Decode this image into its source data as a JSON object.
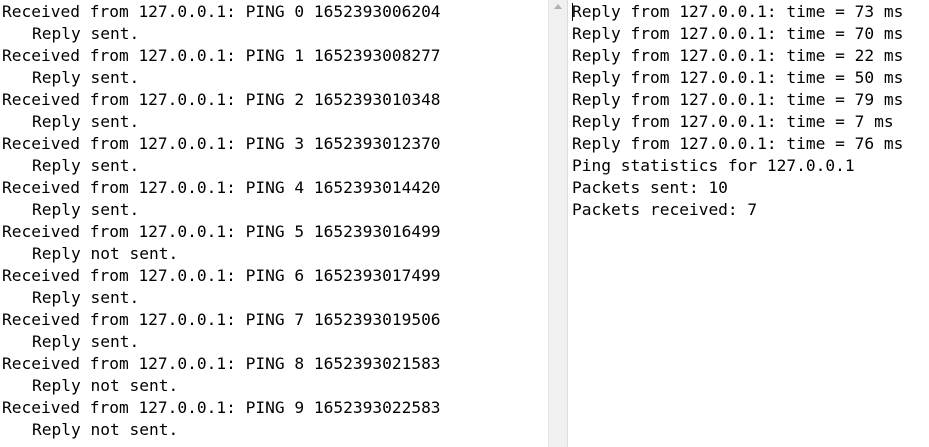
{
  "left_output": [
    {
      "received": "Received from 127.0.0.1: PING 0 1652393006204",
      "reply": "Reply sent."
    },
    {
      "received": "Received from 127.0.0.1: PING 1 1652393008277",
      "reply": "Reply sent."
    },
    {
      "received": "Received from 127.0.0.1: PING 2 1652393010348",
      "reply": "Reply sent."
    },
    {
      "received": "Received from 127.0.0.1: PING 3 1652393012370",
      "reply": "Reply sent."
    },
    {
      "received": "Received from 127.0.0.1: PING 4 1652393014420",
      "reply": "Reply sent."
    },
    {
      "received": "Received from 127.0.0.1: PING 5 1652393016499",
      "reply": "Reply not sent."
    },
    {
      "received": "Received from 127.0.0.1: PING 6 1652393017499",
      "reply": "Reply sent."
    },
    {
      "received": "Received from 127.0.0.1: PING 7 1652393019506",
      "reply": "Reply sent."
    },
    {
      "received": "Received from 127.0.0.1: PING 8 1652393021583",
      "reply": "Reply not sent."
    },
    {
      "received": "Received from 127.0.0.1: PING 9 1652393022583",
      "reply": "Reply not sent."
    }
  ],
  "right_output": [
    "Reply from 127.0.0.1: time = 73 ms",
    "Reply from 127.0.0.1: time = 70 ms",
    "Reply from 127.0.0.1: time = 22 ms",
    "Reply from 127.0.0.1: time = 50 ms",
    "Reply from 127.0.0.1: time = 79 ms",
    "Reply from 127.0.0.1: time = 7 ms",
    "Reply from 127.0.0.1: time = 76 ms",
    "Ping statistics for 127.0.0.1",
    "Packets sent: 10",
    "Packets received: 7"
  ],
  "scrollbar": {
    "up_arrow_icon": "triangle-up"
  }
}
